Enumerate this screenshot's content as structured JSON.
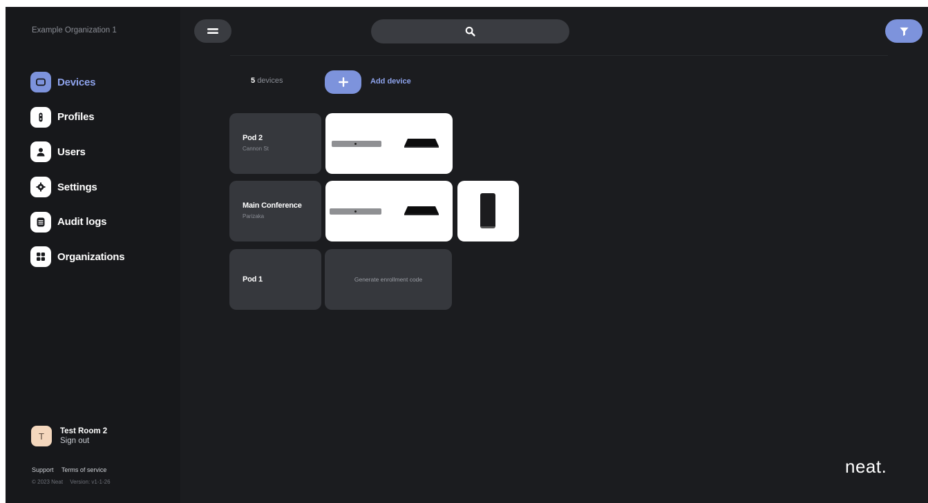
{
  "sidebar": {
    "org_name": "Example Organization 1",
    "nav": [
      {
        "label": "Devices",
        "icon": "devices-icon",
        "active": true
      },
      {
        "label": "Profiles",
        "icon": "profiles-icon",
        "active": false
      },
      {
        "label": "Users",
        "icon": "users-icon",
        "active": false
      },
      {
        "label": "Settings",
        "icon": "settings-icon",
        "active": false
      },
      {
        "label": "Audit logs",
        "icon": "audit-logs-icon",
        "active": false
      },
      {
        "label": "Organizations",
        "icon": "organizations-icon",
        "active": false
      }
    ],
    "user": {
      "initial": "T",
      "name": "Test Room 2",
      "sign_out": "Sign out"
    },
    "footer": {
      "support": "Support",
      "terms": "Terms of service",
      "copyright": "© 2023 Neat",
      "version": "Version: v1-1-26"
    }
  },
  "toolbar": {
    "menu_icon": "menu-icon",
    "search_icon": "search-icon",
    "filter_icon": "filter-icon"
  },
  "devices": {
    "count": "5",
    "count_label": "devices",
    "add_label": "Add device",
    "rooms": [
      {
        "name": "Pod 2",
        "location": "Cannon St"
      },
      {
        "name": "Main Conference",
        "location": "Parizaka"
      },
      {
        "name": "Pod 1",
        "location": ""
      }
    ],
    "enrollment_text": "Generate enrollment code"
  },
  "brand": {
    "logo": "neat.",
    "accent": "#7d93dc"
  }
}
